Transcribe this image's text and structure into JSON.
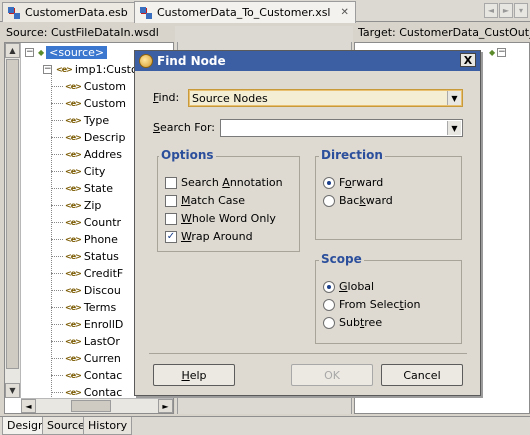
{
  "tabs": [
    {
      "label": "CustomerData.esb",
      "close": "✕"
    },
    {
      "label": "CustomerData_To_Customer.xsl"
    }
  ],
  "nav_icons": [
    "◄",
    "►",
    "▾"
  ],
  "source_header": "Source: CustFileDataIn.wsdl",
  "target_header": "Target: CustomerData_CustOut_R",
  "tree": {
    "root": "<source>",
    "child": "imp1:Custo",
    "icon_glyph": "<e>",
    "items": [
      "Custom",
      "Custom",
      "Type",
      "Descrip",
      "Addres",
      "City",
      "State",
      "Zip",
      "Countr",
      "Phone",
      "Status",
      "CreditF",
      "Discou",
      "Terms",
      "EnrollD",
      "LastOr",
      "Curren",
      "Contac",
      "Contac"
    ]
  },
  "bottom_tabs": [
    "Design",
    "Source",
    "History"
  ],
  "dialog": {
    "title": "Find Node",
    "close": "X",
    "find_label": "Find:",
    "find_value": "Source Nodes",
    "search_label": "Search For:",
    "search_value": "",
    "options_title": "Options",
    "options": [
      {
        "label": "Search Annotation",
        "checked": false
      },
      {
        "label": "Match Case",
        "checked": false
      },
      {
        "label": "Whole Word Only",
        "checked": false
      },
      {
        "label": "Wrap Around",
        "checked": true
      }
    ],
    "direction_title": "Direction",
    "direction": [
      {
        "label": "Forward",
        "selected": true
      },
      {
        "label": "Backward",
        "selected": false
      }
    ],
    "scope_title": "Scope",
    "scope": [
      {
        "label": "Global",
        "selected": true
      },
      {
        "label": "From Selection",
        "selected": false
      },
      {
        "label": "Subtree",
        "selected": false
      }
    ],
    "help_label": "Help",
    "ok_label": "OK",
    "cancel_label": "Cancel"
  },
  "colors": {
    "titlebar": "#3c5fa3",
    "group_title": "#2c4f9c",
    "selection": "#3b77cf"
  }
}
